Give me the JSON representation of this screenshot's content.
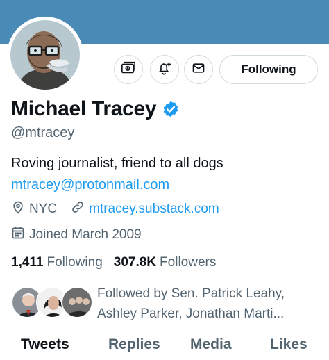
{
  "profile": {
    "name": "Michael Tracey",
    "handle": "@mtracey",
    "bio": "Roving journalist, friend to all dogs",
    "email": "mtracey@protonmail.com",
    "location": "NYC",
    "website": "mtracey.substack.com",
    "joined": "Joined March 2009",
    "verified": true
  },
  "actions": {
    "follow_label": "Following",
    "icons": [
      "subscription-icon",
      "notification-bell-plus-icon",
      "message-envelope-icon"
    ]
  },
  "stats": {
    "following_count": "1,411",
    "following_label": "Following",
    "followers_count": "307.8K",
    "followers_label": "Followers"
  },
  "followed_by": {
    "line1": "Followed by Sen. Patrick Leahy,",
    "line2": "Ashley Parker, Jonathan Marti..."
  },
  "tabs": [
    {
      "label": "Tweets",
      "active": true
    },
    {
      "label": "Replies",
      "active": false
    },
    {
      "label": "Media",
      "active": false
    },
    {
      "label": "Likes",
      "active": false
    }
  ],
  "colors": {
    "banner": "#4a8ab7",
    "link": "#1d9bf0",
    "muted": "#536471",
    "text": "#0f1419"
  }
}
